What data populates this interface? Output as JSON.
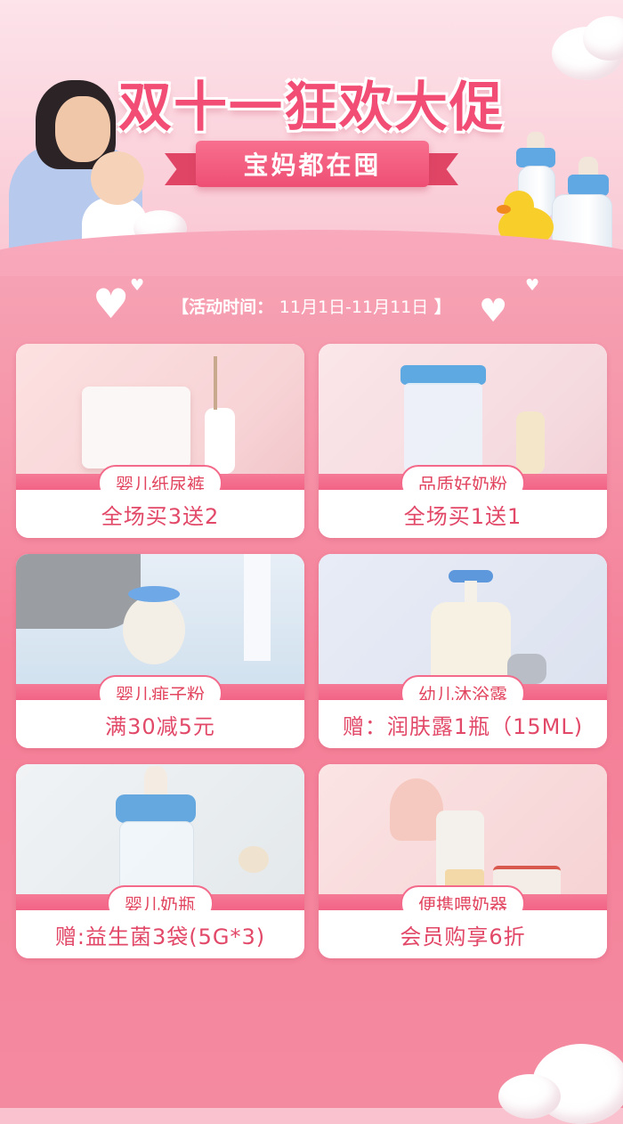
{
  "header": {
    "title": "双十一狂欢大促",
    "subtitle": "宝妈都在囤"
  },
  "event": {
    "bracket_open": "【",
    "label": "活动时间",
    "colon": "：",
    "dates": "11月1日-11月11日",
    "bracket_close": "】"
  },
  "products": [
    {
      "name": "婴儿纸尿裤",
      "offer": "全场买3送2"
    },
    {
      "name": "品质好奶粉",
      "offer": "全场买1送1"
    },
    {
      "name": "婴儿痱子粉",
      "offer": "满30减5元"
    },
    {
      "name": "幼儿沐浴露",
      "offer": "赠：润肤露1瓶（15ML)"
    },
    {
      "name": "婴儿奶瓶",
      "offer": "赠:益生菌3袋(5G*3)"
    },
    {
      "name": "便携喂奶器",
      "offer": "会员购享6折"
    }
  ],
  "colors": {
    "accent": "#f24d74",
    "band": "#f26386",
    "text_red": "#e24969"
  }
}
